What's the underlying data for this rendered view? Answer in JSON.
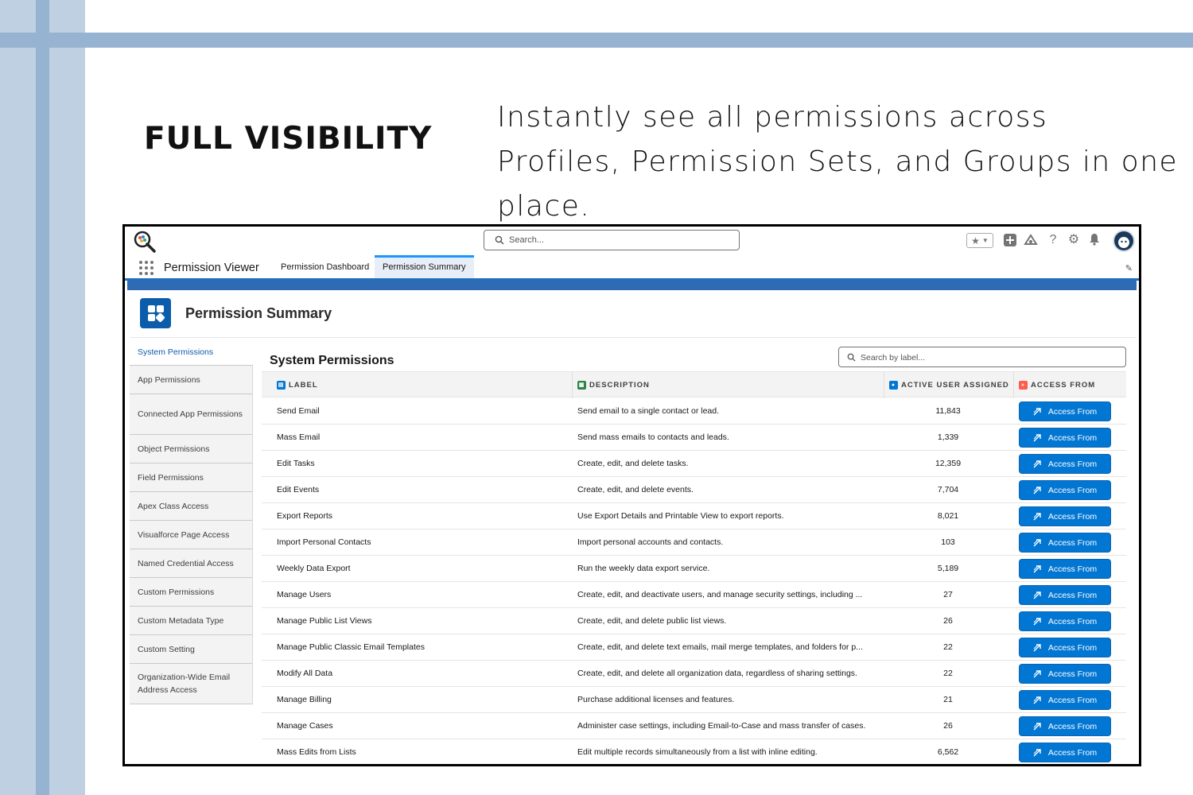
{
  "marketing": {
    "headline": "FULL VISIBILITY",
    "tagline": "Instantly see all permissions across Profiles, Permission Sets, and Groups in one place."
  },
  "colors": {
    "accent": "#0176d3",
    "deco_light": "#bfd0e2",
    "deco_dark": "#97b3d2",
    "header_band": "#2e6bb4"
  },
  "topbar": {
    "search_placeholder": "Search...",
    "icons": [
      "favorites-star-icon",
      "add-icon",
      "trailhead-icon",
      "help-icon",
      "setup-gear-icon",
      "notifications-bell-icon",
      "user-avatar"
    ]
  },
  "nav": {
    "app_name": "Permission Viewer",
    "tabs": [
      {
        "label": "Permission Dashboard",
        "active": false
      },
      {
        "label": "Permission Summary",
        "active": true
      }
    ]
  },
  "page": {
    "title": "Permission Summary"
  },
  "sidebar": {
    "items": [
      {
        "label": "System Permissions",
        "active": true
      },
      {
        "label": "App Permissions",
        "active": false
      },
      {
        "label": "Connected App Permissions",
        "active": false
      },
      {
        "label": "Object Permissions",
        "active": false
      },
      {
        "label": "Field Permissions",
        "active": false
      },
      {
        "label": "Apex Class Access",
        "active": false
      },
      {
        "label": "Visualforce Page Access",
        "active": false
      },
      {
        "label": "Named Credential Access",
        "active": false
      },
      {
        "label": "Custom Permissions",
        "active": false
      },
      {
        "label": "Custom Metadata Type",
        "active": false
      },
      {
        "label": "Custom Setting",
        "active": false
      },
      {
        "label": "Organization-Wide Email Address Access",
        "active": false
      }
    ]
  },
  "section": {
    "title": "System Permissions",
    "search_placeholder": "Search by label..."
  },
  "table": {
    "columns": {
      "label": "LABEL",
      "description": "DESCRIPTION",
      "active_users": "ACTIVE USER ASSIGNED",
      "access_from": "ACCESS FROM"
    },
    "button_label": "Access From",
    "rows": [
      {
        "label": "Send Email",
        "description": "Send email to a single contact or lead.",
        "count": "11,843"
      },
      {
        "label": "Mass Email",
        "description": "Send mass emails to contacts and leads.",
        "count": "1,339"
      },
      {
        "label": "Edit Tasks",
        "description": "Create, edit, and delete tasks.",
        "count": "12,359"
      },
      {
        "label": "Edit Events",
        "description": "Create, edit, and delete events.",
        "count": "7,704"
      },
      {
        "label": "Export Reports",
        "description": "Use Export Details and Printable View to export reports.",
        "count": "8,021"
      },
      {
        "label": "Import Personal Contacts",
        "description": "Import personal accounts and contacts.",
        "count": "103"
      },
      {
        "label": "Weekly Data Export",
        "description": "Run the weekly data export service.",
        "count": "5,189"
      },
      {
        "label": "Manage Users",
        "description": "Create, edit, and deactivate users, and manage security settings, including ...",
        "count": "27"
      },
      {
        "label": "Manage Public List Views",
        "description": "Create, edit, and delete public list views.",
        "count": "26"
      },
      {
        "label": "Manage Public Classic Email Templates",
        "description": "Create, edit, and delete text emails, mail merge templates, and folders for p...",
        "count": "22"
      },
      {
        "label": "Modify All Data",
        "description": "Create, edit, and delete all organization data, regardless of sharing settings.",
        "count": "22"
      },
      {
        "label": "Manage Billing",
        "description": "Purchase additional licenses and features.",
        "count": "21"
      },
      {
        "label": "Manage Cases",
        "description": "Administer case settings, including Email-to-Case and mass transfer of cases.",
        "count": "26"
      },
      {
        "label": "Mass Edits from Lists",
        "description": "Edit multiple records simultaneously from a list with inline editing.",
        "count": "6,562"
      }
    ]
  }
}
